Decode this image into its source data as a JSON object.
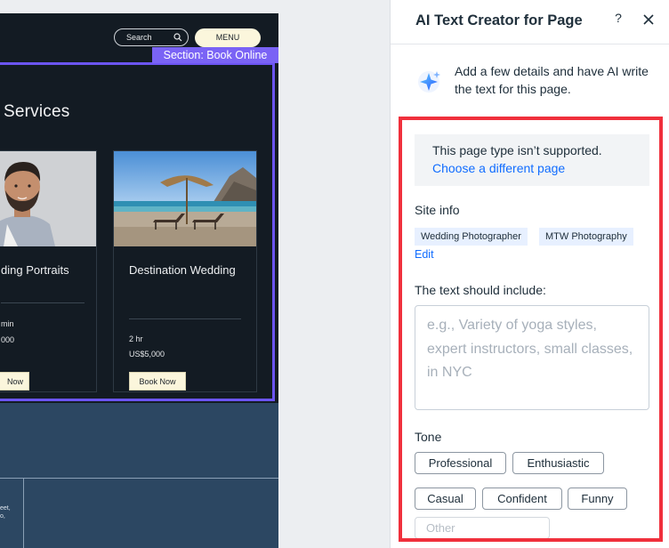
{
  "site": {
    "search_label": "Search",
    "menu_label": "MENU",
    "section_tag": "Section: Book Online",
    "services_title": "r Services",
    "cards": [
      {
        "title": "ding Portraits",
        "meta1": "min",
        "meta2": "000",
        "button": "Now"
      },
      {
        "title": "Destination Wedding",
        "meta1": "2 hr",
        "meta2": "US$5,000",
        "button": "Book Now"
      }
    ],
    "lower_text_1": "eet,",
    "lower_text_2": "o,"
  },
  "panel": {
    "title": "AI Text Creator for Page",
    "help": "?",
    "intro": "Add a few details and have AI write the text for this page.",
    "notice_text": "This page type isn’t supported.",
    "notice_link": "Choose a different page",
    "site_info_label": "Site info",
    "site_info_chips": [
      "Wedding Photographer",
      "MTW Photography"
    ],
    "edit_link": "Edit",
    "include_label": "The text should include:",
    "include_placeholder": "e.g., Variety of yoga styles, expert instructors, small classes, in NYC",
    "tone_label": "Tone",
    "tones": [
      "Professional",
      "Enthusiastic",
      "Casual",
      "Confident",
      "Funny"
    ],
    "tone_other": "Other"
  },
  "colors": {
    "accent": "#116dff",
    "highlight": "#f0303c",
    "section_purple": "#7a63f5",
    "site_bg": "#131b23"
  }
}
